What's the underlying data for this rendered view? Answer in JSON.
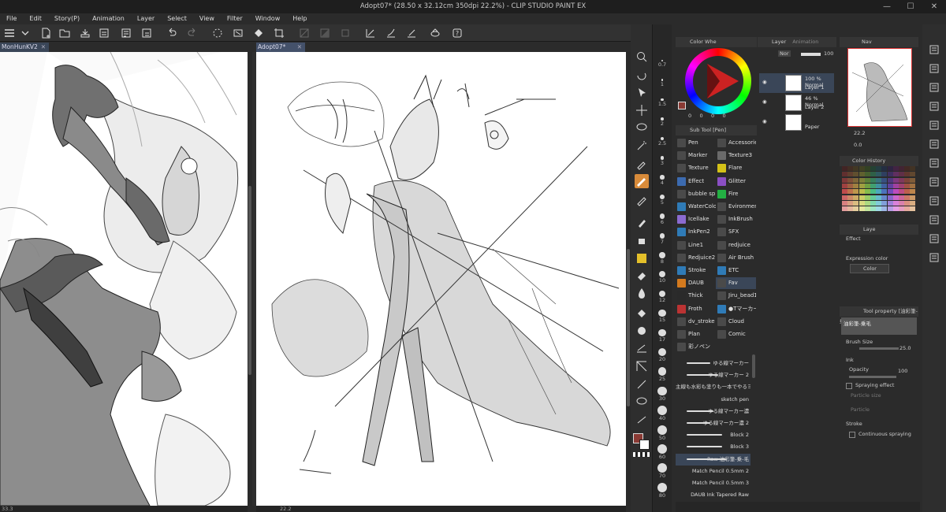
{
  "window": {
    "title": "Adopt07* (28.50 x 32.12cm 350dpi 22.2%) - CLIP STUDIO PAINT EX",
    "min": "—",
    "max": "☐",
    "close": "✕"
  },
  "menu": [
    "File",
    "Edit",
    "Story(P)",
    "Animation",
    "Layer",
    "Select",
    "View",
    "Filter",
    "Window",
    "Help"
  ],
  "tabs": [
    {
      "label": "MonHunKV2",
      "close": "✕"
    },
    {
      "label": "Adopt07*",
      "close": "✕"
    }
  ],
  "status": {
    "left_zoom": "33.3",
    "right_zoom": "22.2"
  },
  "brush_sizes": [
    "0.7",
    "1",
    "1.5",
    "2",
    "2.5",
    "3",
    "4",
    "5",
    "6",
    "7",
    "8",
    "10",
    "12",
    "15",
    "17",
    "20",
    "25",
    "30",
    "40",
    "50",
    "60",
    "70",
    "80"
  ],
  "color_wheel": {
    "panel_title": "Color Whe",
    "values": [
      "0",
      "0",
      "0",
      "0"
    ]
  },
  "subtool_panel": {
    "title": "Sub Tool [Pen]"
  },
  "subtools": [
    {
      "left": "Pen",
      "right": "Accessorie",
      "lc": "#4a4a4a",
      "rc": "#4a4a4a"
    },
    {
      "left": "Marker",
      "right": "Texture3",
      "lc": "#4a4a4a",
      "rc": "#6a6a6a"
    },
    {
      "left": "Texture",
      "right": "Flare",
      "lc": "#4a4a4a",
      "rc": "#d4c218"
    },
    {
      "left": "Effect",
      "right": "Glitter",
      "lc": "#3c6bb0",
      "rc": "#8b4fc4"
    },
    {
      "left": "bubble sp",
      "right": "Fire",
      "lc": "#4a4a4a",
      "rc": "#23b043"
    },
    {
      "left": "WaterColor",
      "right": "Evironment",
      "lc": "#2f7bb7",
      "rc": "#4a4a4a"
    },
    {
      "left": "Icellake",
      "right": "InkBrush",
      "lc": "#8b6bd0",
      "rc": "#4a4a4a"
    },
    {
      "left": "InkPen2",
      "right": "SFX",
      "lc": "#2f7bb7",
      "rc": "#4a4a4a"
    },
    {
      "left": "Line1",
      "right": "redjuice",
      "lc": "#4a4a4a",
      "rc": "#4a4a4a"
    },
    {
      "left": "Redjuice2",
      "right": "Air Brush",
      "lc": "#4a4a4a",
      "rc": "#4a4a4a"
    },
    {
      "left": "Stroke",
      "right": "ETC",
      "lc": "#2f7bb7",
      "rc": "#2f7bb7"
    },
    {
      "left": "DAUB",
      "right": "Fav",
      "lc": "#d47a1e",
      "rc": "#4a4a4a"
    },
    {
      "left": "Thick",
      "right": "Jiru_bead1",
      "lc": "#2a2a2a",
      "rc": "#4a4a4a"
    },
    {
      "left": "Froth",
      "right": "●Tマーカー",
      "lc": "#b33",
      "rc": "#2f7bb7"
    },
    {
      "left": "dv_stroke",
      "right": "Cloud",
      "lc": "#4a4a4a",
      "rc": "#4a4a4a"
    },
    {
      "left": "Plan",
      "right": "Comic",
      "lc": "#4a4a4a",
      "rc": "#4a4a4a"
    },
    {
      "left": "彩ノペン",
      "right": "",
      "lc": "#4a4a4a",
      "rc": ""
    }
  ],
  "brushes": [
    {
      "name": "ゆる線マーカー",
      "w": 30
    },
    {
      "name": "ゆる線マーカー 2",
      "w": 40
    },
    {
      "name": "主線も水彩も塗りも一本でやるヨ",
      "w": 0
    },
    {
      "name": "sketch pen",
      "w": 0
    },
    {
      "name": "ゆる線マーカー濃",
      "w": 34
    },
    {
      "name": "ゆる線マーカー濃 2",
      "w": 30
    },
    {
      "name": "Block 2",
      "w": 45
    },
    {
      "name": "Block 3",
      "w": 45
    },
    {
      "name": "Raw 油彩筆-乗-毛",
      "w": 50
    },
    {
      "name": "Match Pencil 0.5mm 2",
      "w": 0
    },
    {
      "name": "Match Pencil 0.5mm 3",
      "w": 0
    },
    {
      "name": "DAUB Ink Tapered Raw",
      "w": 0
    }
  ],
  "layer_panel": {
    "title": "Layer",
    "tab2": "Animation",
    "blend": "Nor",
    "opacity": "100",
    "layers": [
      {
        "pct": "100 % Normal",
        "name": "Layer 1"
      },
      {
        "pct": "46 % Normal",
        "name": "Layer 2"
      },
      {
        "pct": "",
        "name": "Paper"
      }
    ]
  },
  "navigator": {
    "title": "Nav",
    "zoom": "22.2",
    "angle": "0.0"
  },
  "color_history": {
    "title": "Color History"
  },
  "layer_property": {
    "title": "Laye",
    "effect": "Effect",
    "expression_color": "Expression color",
    "color_value": "Color"
  },
  "tool_property": {
    "title": "Tool property [油彩筆-乗毛]",
    "preview_label": "油彩筆-乗毛",
    "brush_size_label": "Brush Size",
    "brush_size": "25.0",
    "ink": "Ink",
    "opacity_label": "Opacity",
    "opacity": "100",
    "spraying": "Spraying effect",
    "particle_size": "Particle size",
    "particle": "Particle",
    "stroke": "Stroke",
    "continuous": "Continuous spraying"
  },
  "colors": {
    "main_color": "#8a3a34",
    "sub_color": "#ffffff",
    "accent": "#3a4658"
  }
}
